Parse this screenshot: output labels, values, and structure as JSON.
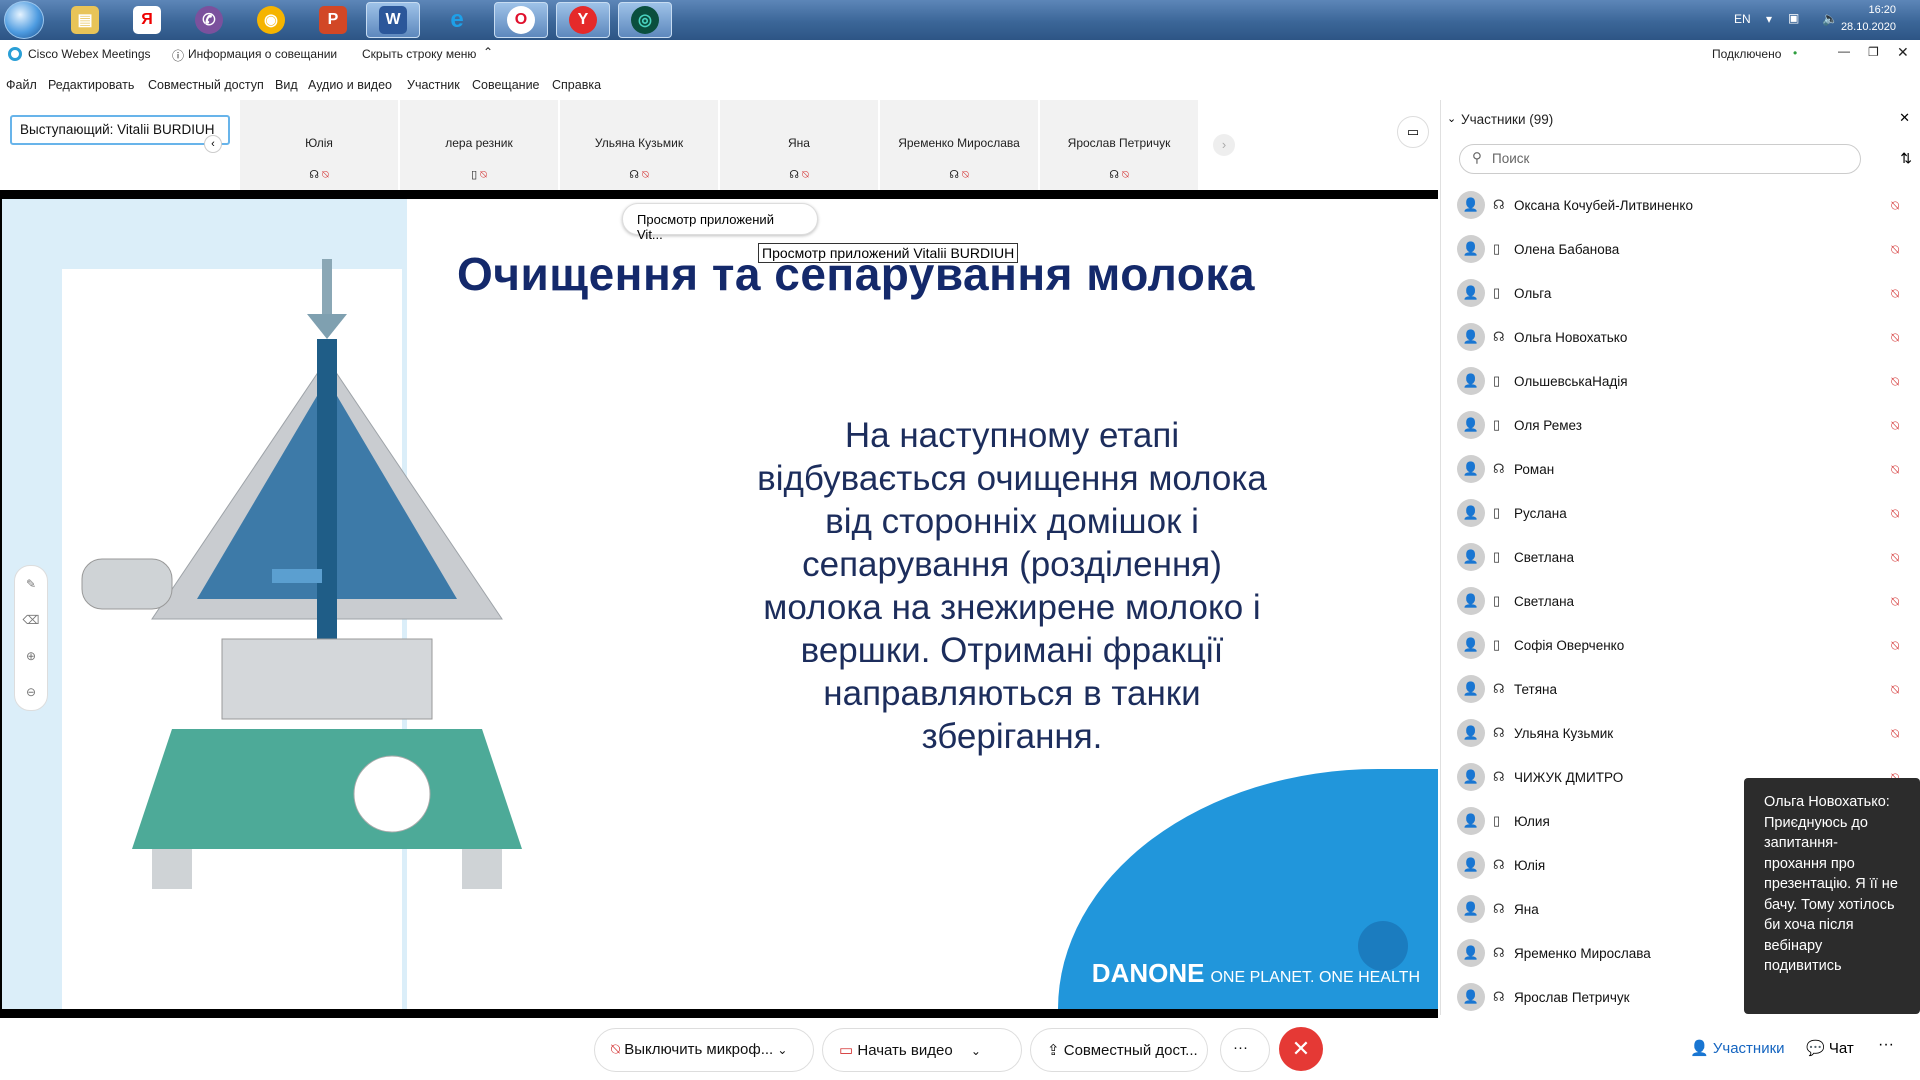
{
  "taskbar": {
    "apps": [
      "start-orb",
      "explorer",
      "yandex-browser-ya",
      "viber",
      "chrome-like",
      "powerpoint",
      "word",
      "internet-explorer",
      "opera",
      "yandex-browser",
      "webex"
    ],
    "lang": "EN",
    "time": "16:20",
    "date": "28.10.2020"
  },
  "titlebar": {
    "app_name": "Cisco Webex Meetings",
    "meeting_info": "Информация о совещании",
    "hide_menu": "Скрыть строку меню",
    "status": "Подключено"
  },
  "menu": [
    "Файл",
    "Редактировать",
    "Совместный доступ",
    "Вид",
    "Аудио и видео",
    "Участник",
    "Совещание",
    "Справка"
  ],
  "speaker_label": "Выступающий: Vitalii BURDIUH",
  "thumbnails": [
    {
      "name": "Юлія",
      "device": "headset"
    },
    {
      "name": "лера резник",
      "device": "phone"
    },
    {
      "name": "Ульяна Кузьмик",
      "device": "headset"
    },
    {
      "name": "Яна",
      "device": "headset"
    },
    {
      "name": "Яременко Мирослава",
      "device": "headset"
    },
    {
      "name": "Ярослав Петричук",
      "device": "headset"
    }
  ],
  "share": {
    "pill": "Просмотр приложений Vit...",
    "tooltip": "Просмотр приложений Vitalii BURDIUH"
  },
  "slide": {
    "title": "Очищення та сепарування молока",
    "body": "На наступному етапі відбувається очищення молока від сторонніх домішок і сепарування (розділення) молока на знежирене молоко і вершки. Отримані фракції направляються в танки зберігання.",
    "brand": "DANONE",
    "slogan": "ONE PLANET. ONE HEALTH"
  },
  "participants_panel": {
    "title": "Участники (99)",
    "search_placeholder": "Поиск",
    "list": [
      {
        "name": "Оксана Кочубей-Литвиненко",
        "device": "headset"
      },
      {
        "name": "Олена Бабанова",
        "device": "phone"
      },
      {
        "name": "Ольга",
        "device": "phone"
      },
      {
        "name": "Ольга Новохатько",
        "device": "headset"
      },
      {
        "name": "ОльшевськаНадія",
        "device": "phone"
      },
      {
        "name": "Оля Ремез",
        "device": "phone"
      },
      {
        "name": "Роман",
        "device": "headset"
      },
      {
        "name": "Руслана",
        "device": "phone"
      },
      {
        "name": "Светлана",
        "device": "phone"
      },
      {
        "name": "Светлана",
        "device": "phone"
      },
      {
        "name": "Софія Оверченко",
        "device": "phone"
      },
      {
        "name": "Тетяна",
        "device": "headset"
      },
      {
        "name": "Ульяна Кузьмик",
        "device": "headset"
      },
      {
        "name": "ЧИЖУК ДМИТРО",
        "device": "headset"
      },
      {
        "name": "Юлия",
        "device": "phone"
      },
      {
        "name": "Юлія",
        "device": "headset"
      },
      {
        "name": "Яна",
        "device": "headset"
      },
      {
        "name": "Яременко Мирослава",
        "device": "headset"
      },
      {
        "name": "Ярослав Петричук",
        "device": "headset"
      }
    ]
  },
  "chat_popup": "Ольга Новохатько: Приєднуюсь до запитання-прохання про презентацію. Я її не бачу. Тому хотілось би хоча після вебінару подивитись",
  "bottom": {
    "mute": "Выключить микроф...",
    "video": "Начать видео",
    "share": "Совместный дост...",
    "more": "···",
    "participants": "Участники",
    "chat": "Чат"
  },
  "colors": {
    "accent": "#2196db",
    "mute": "#d32f2f",
    "end": "#e53935",
    "slide_title": "#14296b"
  }
}
